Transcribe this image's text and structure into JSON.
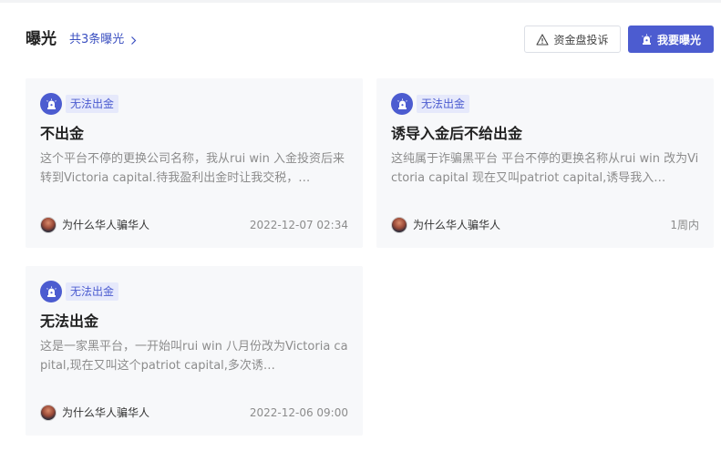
{
  "header": {
    "title": "曝光",
    "count_text": "共3条曝光",
    "report_button": "资金盘投诉",
    "expose_button": "我要曝光"
  },
  "cards": [
    {
      "tag": "无法出金",
      "title": "不出金",
      "body": "这个平台不停的更换公司名称，我从rui win 入金投资后来转到Victoria capital.待我盈利出金时让我交税，…",
      "author": "为什么华人骗华人",
      "time": "2022-12-07 02:34"
    },
    {
      "tag": "无法出金",
      "title": "诱导入金后不给出金",
      "body": "这纯属于诈骗黑平台 平台不停的更换名称从rui win 改为Victoria capital 现在又叫patriot capital,诱导我入…",
      "author": "为什么华人骗华人",
      "time": "1周内"
    },
    {
      "tag": "无法出金",
      "title": "无法出金",
      "body": "这是一家黑平台，一开始叫rui win 八月份改为Victoria capital,现在又叫这个patriot capital,多次诱…",
      "author": "为什么华人骗华人",
      "time": "2022-12-06 09:00"
    }
  ],
  "colors": {
    "accent": "#4c5cd0",
    "tag_bg": "#e6e9fb",
    "card_bg": "#f7f8fa"
  },
  "icons": {
    "count_arrow": "chevron-right-icon",
    "report": "warning-triangle-icon",
    "expose": "alarm-bell-icon",
    "tag": "alarm-bell-icon"
  }
}
